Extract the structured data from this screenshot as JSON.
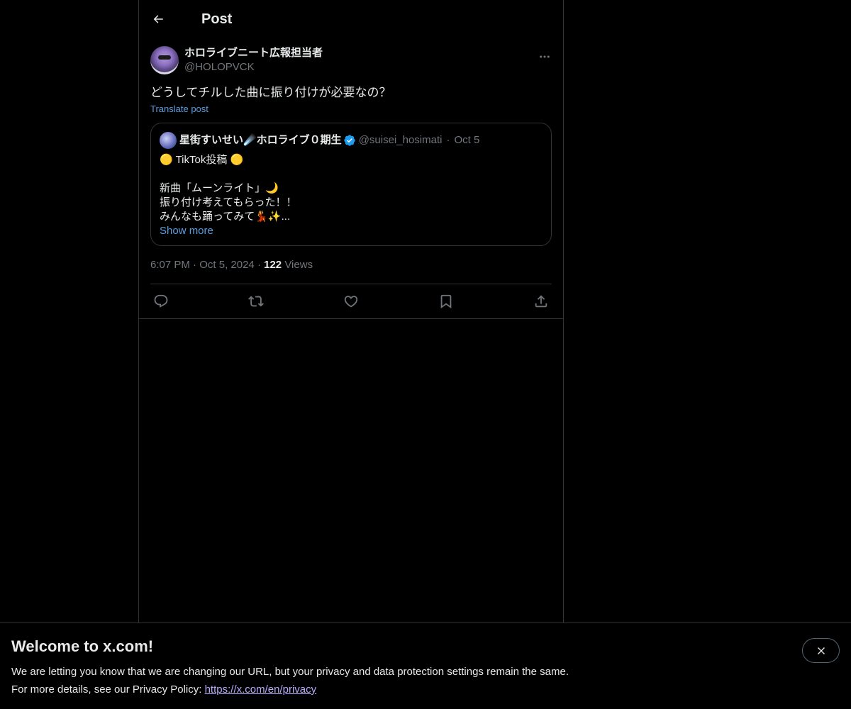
{
  "header": {
    "title": "Post"
  },
  "author": {
    "display_name": "ホロライブニート広報担当者",
    "handle": "@HOLOPVCK"
  },
  "post": {
    "text": "どうしてチルした曲に振り付けが必要なの？",
    "translate_label": "Translate post",
    "timestamp_time": "6:07 PM",
    "timestamp_date": "Oct 5, 2024",
    "views_count": "122",
    "views_label": "Views"
  },
  "quote": {
    "display_name": "星街すいせい☄️ホロライブ０期生",
    "handle": "@suisei_hosimati",
    "date": "Oct 5",
    "line1": "🟡 TikTok投稿 🟡",
    "body": "新曲「ムーンライト」🌙\n振り付け考えてもらった！！\nみんなも踊ってみて💃✨...",
    "show_more": "Show more"
  },
  "actions": {
    "reply": "reply-icon",
    "repost": "repost-icon",
    "like": "like-icon",
    "bookmark": "bookmark-icon",
    "share": "share-icon"
  },
  "banner": {
    "title": "Welcome to x.com!",
    "line1": "We are letting you know that we are changing our URL, but your privacy and data protection settings remain the same.",
    "line2_prefix": "For more details, see our Privacy Policy: ",
    "link": "https://x.com/en/privacy"
  },
  "colors": {
    "accent": "#1d9bf0",
    "link_purple": "#b9a9ff",
    "border": "#2f3336",
    "muted": "#71767b"
  }
}
